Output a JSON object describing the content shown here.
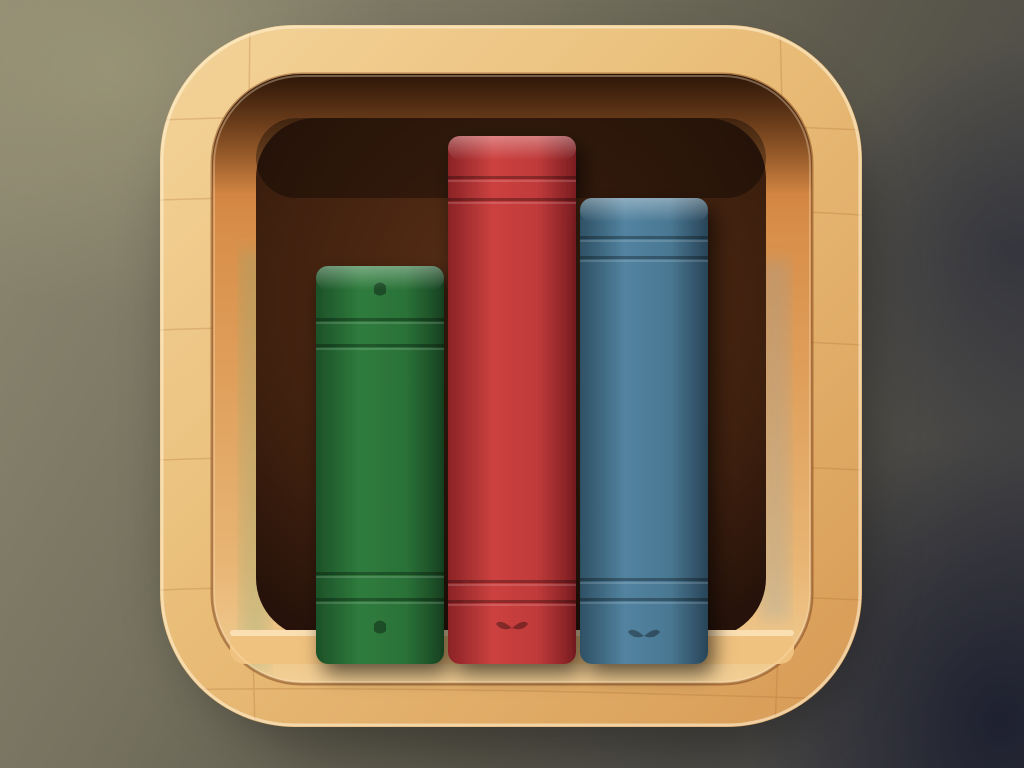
{
  "title": "",
  "image": {
    "subject": "bookshelf-app-icon",
    "frame_material": "wood",
    "colors": {
      "background": "#6f6b5a",
      "wood_light": "#f2cf8f",
      "wood_mid": "#dca460",
      "wood_dark": "#8a4a1e",
      "shelf_back": "#3d1f0e"
    }
  },
  "books": [
    {
      "name": "green-book",
      "color": "#2f7a3c",
      "color_dark": "#1c4f27",
      "emblem": "shield-emblem"
    },
    {
      "name": "red-book",
      "color": "#c23b3b",
      "color_dark": "#7e1f22",
      "emblem": "leaf-emblem"
    },
    {
      "name": "blue-book",
      "color": "#4a7893",
      "color_dark": "#2b4b60",
      "emblem": "leaf-emblem"
    }
  ]
}
